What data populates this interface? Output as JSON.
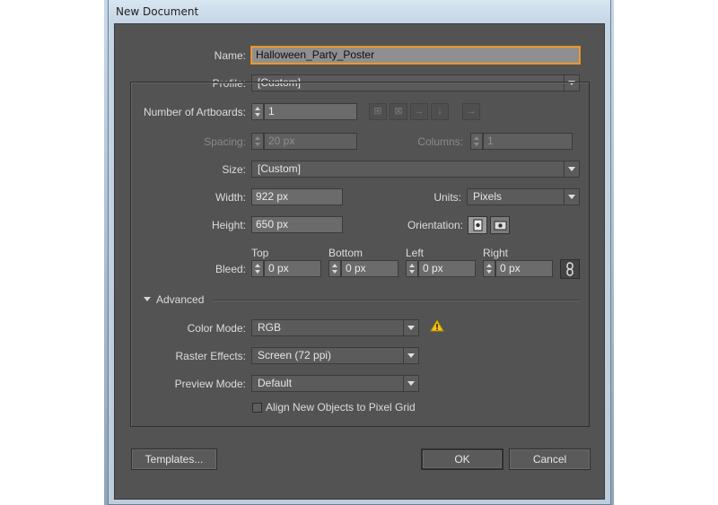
{
  "window": {
    "title": "New Document"
  },
  "name": {
    "label": "Name:",
    "value": "Halloween_Party_Poster"
  },
  "profile": {
    "label": "Profile:",
    "value": "[Custom]"
  },
  "artboards": {
    "label": "Number of Artboards:",
    "value": "1"
  },
  "spacing": {
    "label": "Spacing:",
    "value": "20 px"
  },
  "columns": {
    "label": "Columns:",
    "value": "1"
  },
  "size": {
    "label": "Size:",
    "value": "[Custom]"
  },
  "width": {
    "label": "Width:",
    "value": "922 px"
  },
  "units": {
    "label": "Units:",
    "value": "Pixels"
  },
  "height": {
    "label": "Height:",
    "value": "650 px"
  },
  "orientation": {
    "label": "Orientation:",
    "selected": "portrait"
  },
  "bleed": {
    "label": "Bleed:",
    "top": {
      "label": "Top",
      "value": "0 px"
    },
    "bottom": {
      "label": "Bottom",
      "value": "0 px"
    },
    "left": {
      "label": "Left",
      "value": "0 px"
    },
    "right": {
      "label": "Right",
      "value": "0 px"
    }
  },
  "advanced": {
    "label": "Advanced",
    "color_mode": {
      "label": "Color Mode:",
      "value": "RGB"
    },
    "raster_effects": {
      "label": "Raster Effects:",
      "value": "Screen (72 ppi)"
    },
    "preview_mode": {
      "label": "Preview Mode:",
      "value": "Default"
    },
    "align_pixel_grid": {
      "label": "Align New Objects to Pixel Grid",
      "checked": false
    }
  },
  "buttons": {
    "templates": "Templates...",
    "ok": "OK",
    "cancel": "Cancel"
  },
  "colors": {
    "dialog_bg": "#535353",
    "focus_ring": "#f0a030",
    "warning": "#f5c518"
  }
}
